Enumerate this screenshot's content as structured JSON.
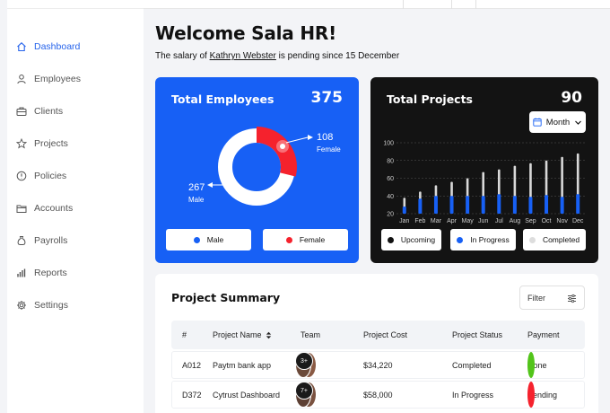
{
  "sidebar": {
    "items": [
      {
        "label": "Dashboard",
        "icon": "home-icon",
        "active": true
      },
      {
        "label": "Employees",
        "icon": "person-icon"
      },
      {
        "label": "Clients",
        "icon": "briefcase-icon"
      },
      {
        "label": "Projects",
        "icon": "star-icon"
      },
      {
        "label": "Policies",
        "icon": "info-icon"
      },
      {
        "label": "Accounts",
        "icon": "folder-icon"
      },
      {
        "label": "Payrolls",
        "icon": "money-bag-icon"
      },
      {
        "label": "Reports",
        "icon": "bar-chart-icon"
      },
      {
        "label": "Settings",
        "icon": "gear-icon"
      }
    ]
  },
  "header": {
    "title": "Welcome Sala HR!",
    "subtitle_prefix": "The salary of ",
    "subtitle_link": "Kathryn Webster",
    "subtitle_suffix": " is pending since 15 December"
  },
  "employees_card": {
    "title": "Total Employees",
    "total": "375",
    "female_value": "108",
    "female_label": "Female",
    "male_value": "267",
    "male_label": "Male",
    "legend_male": "Male",
    "legend_female": "Female",
    "colors": {
      "male": "#1760f5",
      "female": "#f5222d"
    }
  },
  "projects_card": {
    "title": "Total Projects",
    "total": "90",
    "period_label": "Month",
    "legend": [
      {
        "label": "Upcoming",
        "color": "#111111"
      },
      {
        "label": "In Progress",
        "color": "#1760f5"
      },
      {
        "label": "Completed",
        "color": "#dddddd"
      }
    ]
  },
  "chart_data": {
    "type": "bar",
    "title": "Total Projects",
    "categories": [
      "Jan",
      "Feb",
      "Mar",
      "Apr",
      "May",
      "Jun",
      "Jul",
      "Aug",
      "Sep",
      "Oct",
      "Nov",
      "Dec"
    ],
    "series": [
      {
        "name": "Completed",
        "values": [
          38,
          45,
          52,
          56,
          60,
          67,
          70,
          74,
          77,
          80,
          84,
          88
        ]
      },
      {
        "name": "In Progress",
        "values": [
          28,
          37,
          40,
          40,
          40,
          40,
          42,
          40,
          39,
          41,
          39,
          42
        ]
      }
    ],
    "yticks": [
      100,
      80,
      60,
      40,
      20
    ],
    "ylim": [
      20,
      100
    ],
    "grid": true
  },
  "summary": {
    "title": "Project Summary",
    "filter_label": "Filter",
    "columns": [
      "#",
      "Project Name",
      "Team",
      "Project Cost",
      "Project Status",
      "Payment"
    ],
    "rows": [
      {
        "id": "A012",
        "name": "Paytm bank app",
        "team_more": "3+",
        "cost": "$34,220",
        "status": "Completed",
        "payment": "Done",
        "payment_color": "#52c41a"
      },
      {
        "id": "D372",
        "name": "Cytrust Dashboard",
        "team_more": "7+",
        "cost": "$58,000",
        "status": "In Progress",
        "payment": "Pending",
        "payment_color": "#f5222d"
      }
    ]
  }
}
